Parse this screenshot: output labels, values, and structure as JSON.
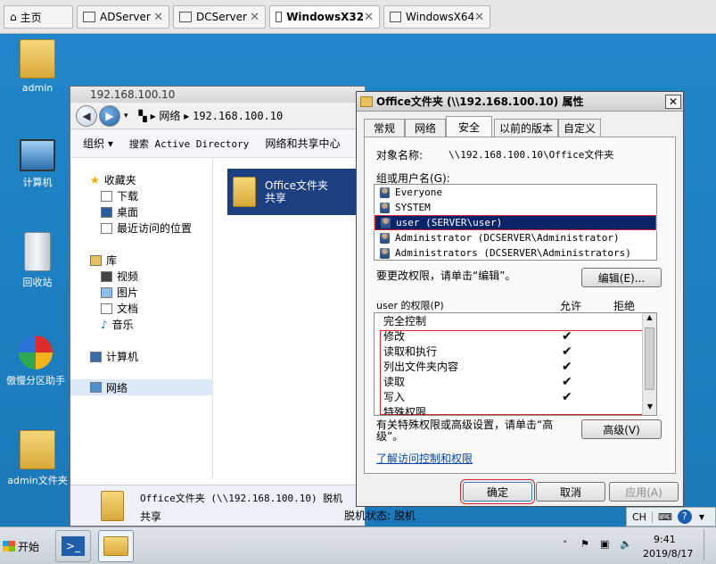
{
  "tabs": [
    {
      "label": "主页",
      "active": false,
      "closable": false
    },
    {
      "label": "ADServer",
      "active": false,
      "closable": true
    },
    {
      "label": "DCServer",
      "active": false,
      "closable": true
    },
    {
      "label": "WindowsX32",
      "active": true,
      "closable": true
    },
    {
      "label": "WindowsX64",
      "active": false,
      "closable": true
    }
  ],
  "desktop_icons": [
    "admin",
    "计算机",
    "回收站",
    "傲慢分区助手",
    "admin文件夹"
  ],
  "explorer": {
    "title": "192.168.100.10",
    "breadcrumb": [
      "网络",
      "192.168.100.10"
    ],
    "toolbar": [
      "组织 ▾",
      "搜索 Active Directory",
      "网络和共享中心"
    ],
    "nav": {
      "favorites_label": "收藏夹",
      "favorites": [
        "下载",
        "桌面",
        "最近访问的位置"
      ],
      "libraries_label": "库",
      "libraries": [
        "视频",
        "图片",
        "文档",
        "音乐"
      ],
      "computer": "计算机",
      "network": "网络"
    },
    "item": {
      "name_line1": "Office文件夹",
      "name_line2": "共享"
    },
    "details": {
      "name": "Office文件夹 (\\\\192.168.100.10) 脱机",
      "type": "共享",
      "offline_status": "脱机状态: 脱机"
    }
  },
  "dialog": {
    "title": "Office文件夹 (\\\\192.168.100.10) 属性",
    "tabs": [
      "常规",
      "网络",
      "安全",
      "以前的版本",
      "自定义"
    ],
    "active_tab": "安全",
    "object_label": "对象名称:",
    "object_value": "\\\\192.168.100.10\\Office文件夹",
    "groups_label": "组或用户名(G):",
    "groups": [
      "Everyone",
      "SYSTEM",
      "user (SERVER\\user)",
      "Administrator (DCSERVER\\Administrator)",
      "Administrators (DCSERVER\\Administrators)"
    ],
    "selected_group_index": 2,
    "change_hint": "要更改权限，请单击“编辑”。",
    "edit_button": "编辑(E)...",
    "perms_label": "user 的权限(P)",
    "allow_label": "允许",
    "deny_label": "拒绝",
    "permissions": [
      {
        "name": "完全控制",
        "allow": false
      },
      {
        "name": "修改",
        "allow": true
      },
      {
        "name": "读取和执行",
        "allow": true
      },
      {
        "name": "列出文件夹内容",
        "allow": true
      },
      {
        "name": "读取",
        "allow": true
      },
      {
        "name": "写入",
        "allow": true
      },
      {
        "name": "特殊权限",
        "allow": false
      }
    ],
    "advanced_hint": "有关特殊权限或高级设置，请单击“高级”。",
    "advanced_button": "高级(V)",
    "link": "了解访问控制和权限",
    "ok": "确定",
    "cancel": "取消",
    "apply": "应用(A)"
  },
  "taskbar": {
    "start": "开始",
    "time": "9:41",
    "date": "2019/8/17",
    "lang": "CH"
  },
  "colors": {
    "desktop": "#1f7fbf",
    "selection": "#0a246a",
    "highlight_box": "#d9232e"
  }
}
